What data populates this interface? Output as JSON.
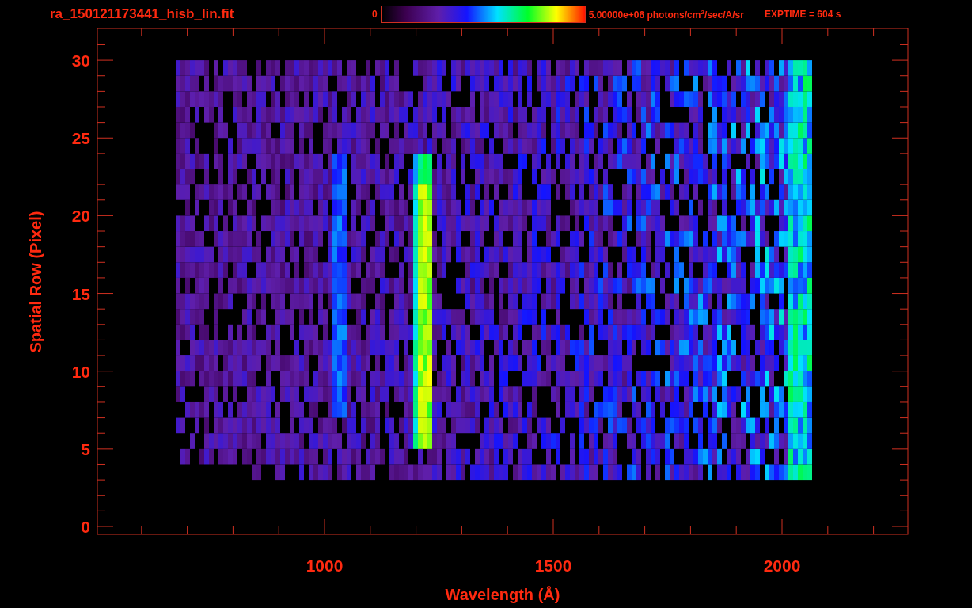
{
  "header": {
    "file_name": "ra_150121173441_hisb_lin.fit",
    "colorbar_min": "0",
    "colorbar_max": "5.00000e+06 photons/cm$^{2}$/sec/A/sr",
    "exposure": "EXPTIME = 604 s"
  },
  "plot": {
    "xlabel": "Wavelength (Å)",
    "ylabel": "Spatial Row (Pixel)",
    "xtick_labels": [
      "1000",
      "1500",
      "2000"
    ],
    "ytick_labels": [
      "30",
      "25",
      "20",
      "15",
      "10",
      "5",
      "0"
    ]
  }
}
